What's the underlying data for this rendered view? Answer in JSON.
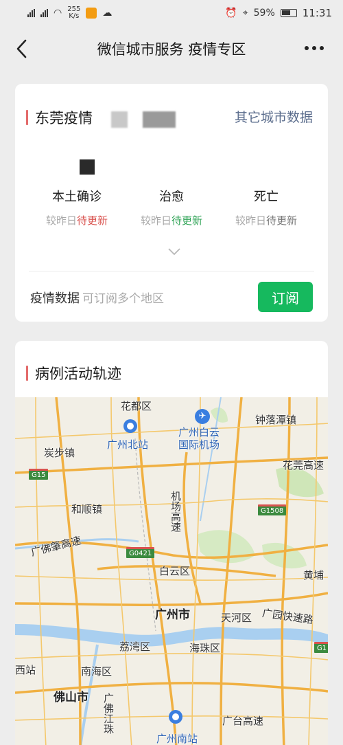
{
  "status_bar": {
    "speed": "255",
    "speed_unit": "K/s",
    "battery": "59%",
    "time": "11:31",
    "net1": "4G",
    "net2": "4G"
  },
  "nav": {
    "title": "微信城市服务 疫情专区",
    "back_icon": "back-arrow-icon",
    "more_icon": "more-dots-icon"
  },
  "epidemic_card": {
    "title": "东莞疫情",
    "other_cities": "其它城市数据",
    "stats": [
      {
        "label": "本土确诊",
        "prefix": "较昨日",
        "status": "待更新",
        "status_color": "#d9534f"
      },
      {
        "label": "治愈",
        "prefix": "较昨日",
        "status": "待更新",
        "status_color": "#2fa356"
      },
      {
        "label": "死亡",
        "prefix": "较昨日",
        "status": "待更新",
        "status_color": "#777777"
      }
    ],
    "subscribe_label": "疫情数据",
    "subscribe_hint": "可订阅多个地区",
    "subscribe_button": "订阅"
  },
  "track_card": {
    "title": "病例活动轨迹",
    "map": {
      "labels": {
        "huadu": "花都区",
        "gz_north": "广州北站",
        "baiyun_airport": "广州白云国际机场",
        "zhongluotan": "钟落潭镇",
        "tanbu": "炭步镇",
        "huaguan": "花莞高速",
        "heshun": "和顺镇",
        "airport_hwy": "机场高速",
        "guangfozhao": "广佛肇高速",
        "baiyun": "白云区",
        "huangpu": "黄埔",
        "gz_city": "广州市",
        "tianhe": "天河区",
        "guangyuan": "广园快速路",
        "liwan": "荔湾区",
        "haizhu": "海珠区",
        "west_station": "西站",
        "nanhai": "南海区",
        "foshan": "佛山市",
        "guangfo_jiang": "广佛江珠",
        "gz_south": "广州南站",
        "guangtai": "广台高速"
      },
      "badges": {
        "g15": "G15",
        "g1508": "G1508",
        "g0421": "G0421",
        "g1": "G1"
      }
    }
  }
}
